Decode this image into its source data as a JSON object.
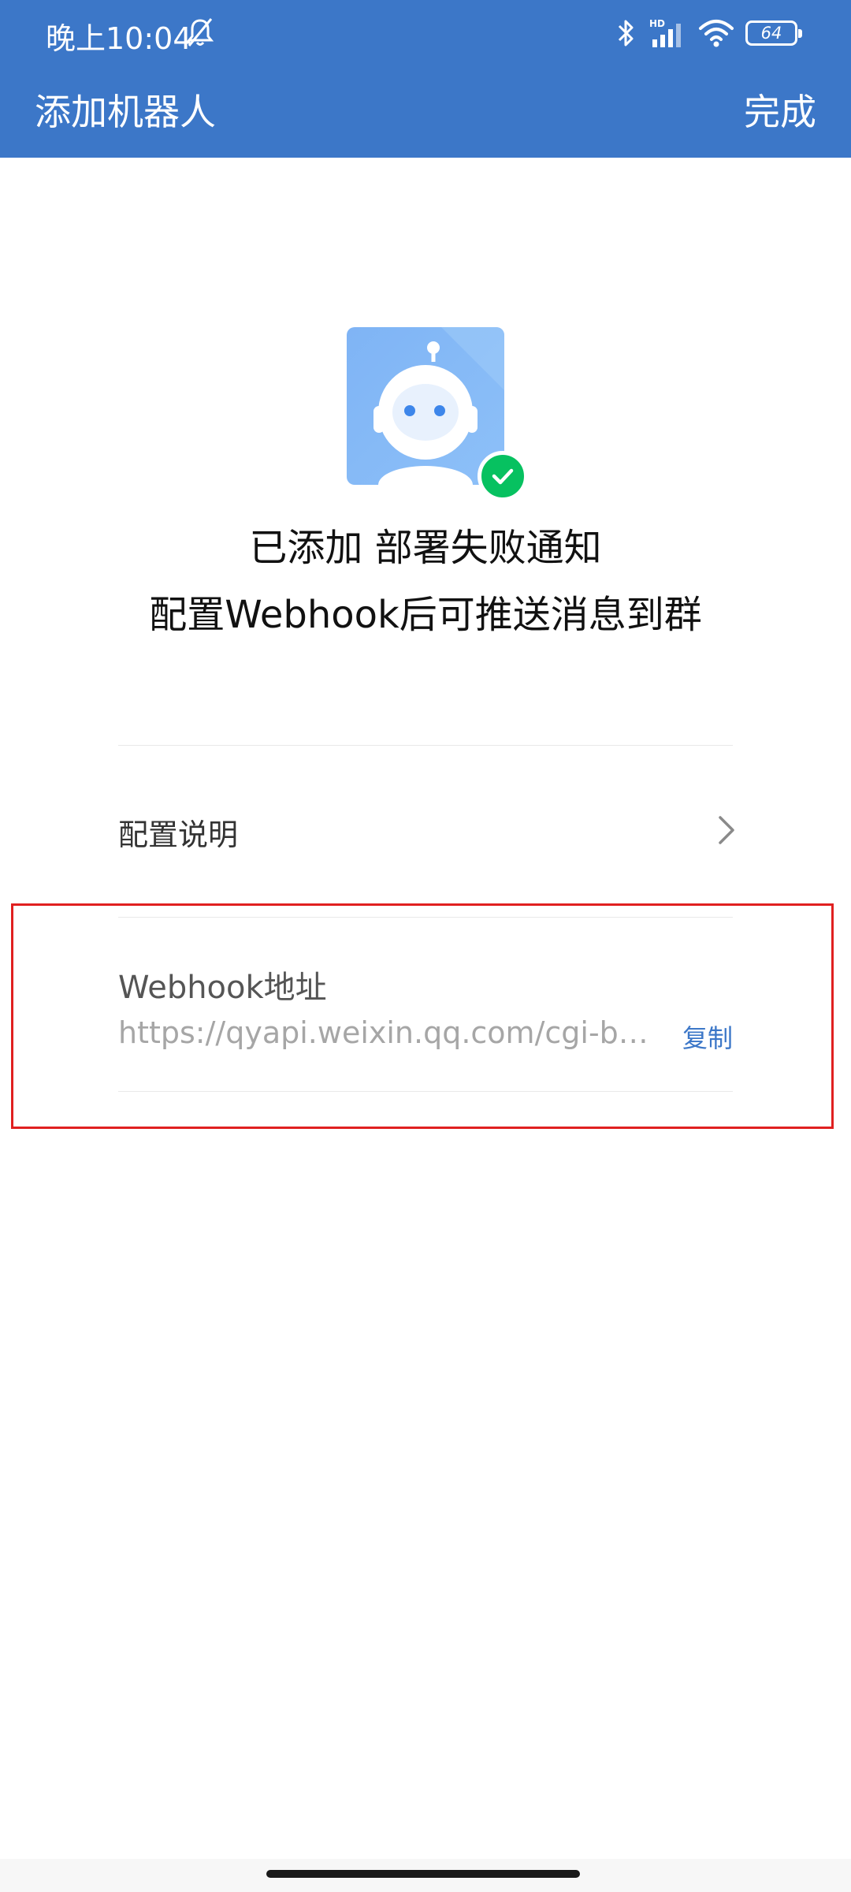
{
  "status_bar": {
    "time": "晚上10:04",
    "battery": "64",
    "network": "HD"
  },
  "nav": {
    "title": "添加机器人",
    "done_label": "完成"
  },
  "robot": {
    "added_title": "已添加 部署失败通知",
    "subtitle": "配置Webhook后可推送消息到群"
  },
  "config": {
    "label": "配置说明"
  },
  "webhook": {
    "label": "Webhook地址",
    "url": "https://qyapi.weixin.qq.com/cgi-b…",
    "copy_label": "复制"
  },
  "colors": {
    "header": "#3c77c8",
    "success": "#07c160",
    "link": "#3c77c8",
    "highlight": "#e02020"
  },
  "icons": [
    "bell-off-icon",
    "bluetooth-icon",
    "signal-icon",
    "wifi-icon",
    "battery-icon",
    "robot-avatar",
    "check-icon",
    "chevron-right-icon"
  ]
}
